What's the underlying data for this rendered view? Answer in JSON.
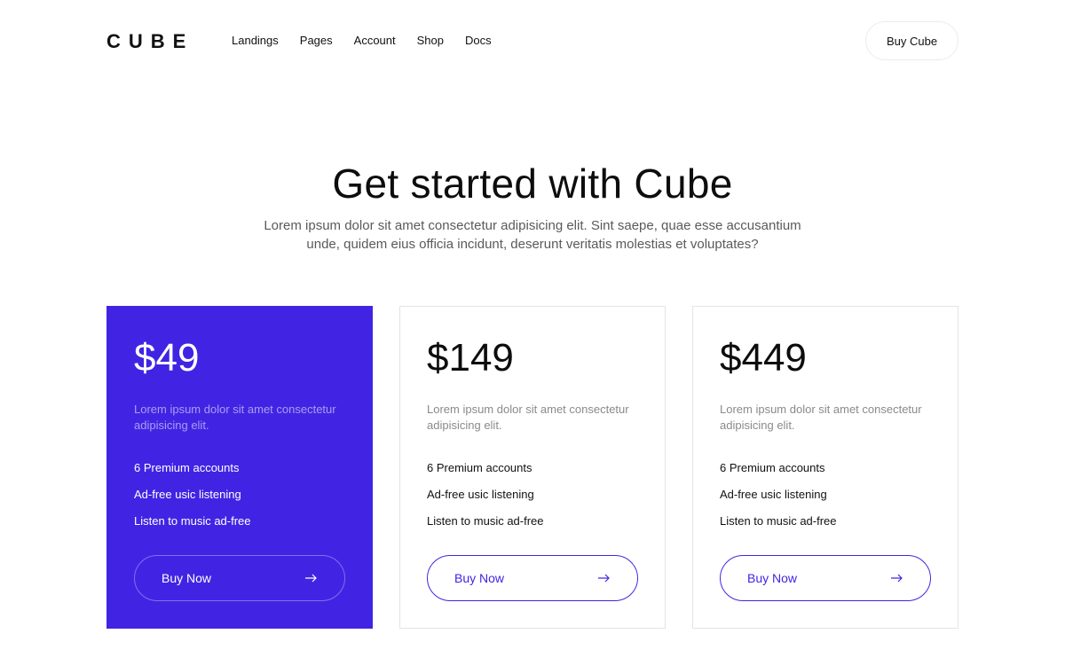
{
  "brand": {
    "logo": "CUBE"
  },
  "nav": {
    "items": [
      {
        "label": "Landings"
      },
      {
        "label": "Pages"
      },
      {
        "label": "Account"
      },
      {
        "label": "Shop"
      },
      {
        "label": "Docs"
      }
    ],
    "cta": "Buy Cube"
  },
  "hero": {
    "title": "Get started with Cube",
    "subtitle": "Lorem ipsum dolor sit amet consectetur adipisicing elit. Sint saepe, quae esse accusantium unde, quidem eius officia incidunt, deserunt veritatis molestias et voluptates?"
  },
  "accent_color": "#4124e3",
  "plans": [
    {
      "price": "$49",
      "description": "Lorem ipsum dolor sit amet consectetur adipisicing elit.",
      "features": [
        "6 Premium accounts",
        "Ad-free usic listening",
        "Listen to music ad-free"
      ],
      "button": "Buy Now",
      "featured": true
    },
    {
      "price": "$149",
      "description": "Lorem ipsum dolor sit amet consectetur adipisicing elit.",
      "features": [
        "6 Premium accounts",
        "Ad-free usic listening",
        "Listen to music ad-free"
      ],
      "button": "Buy Now",
      "featured": false
    },
    {
      "price": "$449",
      "description": "Lorem ipsum dolor sit amet consectetur adipisicing elit.",
      "features": [
        "6 Premium accounts",
        "Ad-free usic listening",
        "Listen to music ad-free"
      ],
      "button": "Buy Now",
      "featured": false
    }
  ],
  "icons": {
    "buy_arrow": "arrow-right-icon"
  }
}
